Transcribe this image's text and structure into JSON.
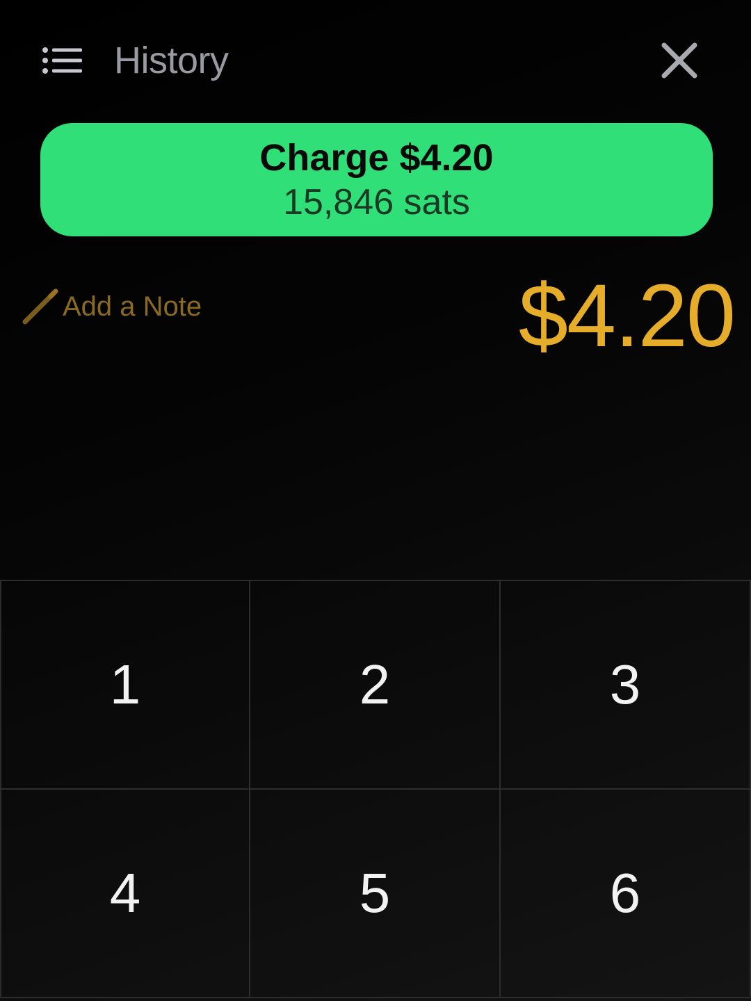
{
  "header": {
    "history_label": "History",
    "history_icon": "list-icon",
    "close_icon": "close-icon"
  },
  "charge": {
    "title": "Charge $4.20",
    "sats": "15,846 sats",
    "color": "#31df79"
  },
  "note": {
    "label": "Add a Note",
    "icon": "pencil-icon",
    "color": "#8a6a22"
  },
  "amount": {
    "display": "$4.20",
    "color": "#e6ad2b"
  },
  "keypad": {
    "keys": [
      "1",
      "2",
      "3",
      "4",
      "5",
      "6"
    ]
  }
}
